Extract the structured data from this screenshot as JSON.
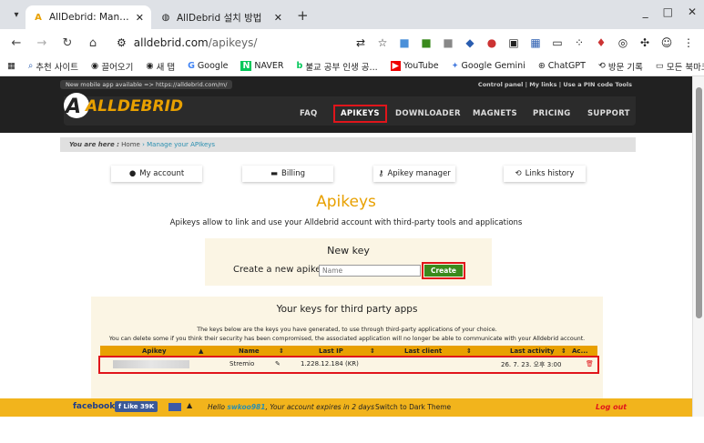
{
  "browser": {
    "tabs": [
      {
        "title": "AllDebrid: Manage your API",
        "active": true
      },
      {
        "title": "AllDebrid 설치 방법",
        "active": false
      }
    ],
    "url_scheme": "alldebrid.com",
    "url_path": "/apikeys/",
    "bookmarks": [
      "추천 사이트",
      "끌어오기",
      "새 탭",
      "Google",
      "NAVER",
      "불교 공부 인생 공...",
      "YouTube",
      "Google Gemini",
      "ChatGPT",
      "방문 기록"
    ],
    "all_bookmarks": "모든 북마크"
  },
  "site": {
    "notice": "New mobile app available => https://alldebrid.com/m/",
    "toplinks": "Control panel | My links | Use a PIN code   Tools",
    "logo_text": "ALLDEBRID",
    "nav": [
      "FAQ",
      "APIKEYS",
      "DOWNLOADER",
      "MAGNETS",
      "PRICING",
      "SUPPORT"
    ],
    "breadcrumb": {
      "label": "You are here :",
      "home": "Home",
      "current": "Manage your APIkeys"
    },
    "subnav": [
      "My account",
      "Billing",
      "Apikey manager",
      "Links history"
    ]
  },
  "main": {
    "title": "Apikeys",
    "description": "Apikeys allow to link and use your Alldebrid account with third-party tools and applications",
    "new_key": {
      "heading": "New key",
      "label": "Create a new apikey :",
      "placeholder": "Name",
      "button": "Create"
    },
    "keys": {
      "heading": "Your keys for third party apps",
      "p1": "The keys below are the keys you have generated, to use through third-party applications of your choice.",
      "p2": "You can delete some if you think their security has been compromised, the associated application will no longer be able to communicate with your Alldebrid account.",
      "columns": [
        "Apikey",
        "Name",
        "Last IP",
        "Last client",
        "Last activity",
        "Ac..."
      ],
      "rows": [
        {
          "name": "Stremio",
          "last_ip": "1.228.12.184 (KR)",
          "last_client": "",
          "last_activity": "26. 7. 23. 오후 3:00"
        }
      ]
    }
  },
  "footer": {
    "facebook": "facebook",
    "like": "f Like 39K",
    "hello_prefix": "Hello ",
    "username": "swkoo981",
    "hello_suffix": ", Your account expires in 2 days",
    "dark_theme": "Switch to Dark Theme",
    "logout": "Log out"
  },
  "colors": {
    "accent": "#e8a000",
    "red_highlight": "#e0151b",
    "create_green": "#3a8a1c",
    "header": "#212121"
  }
}
